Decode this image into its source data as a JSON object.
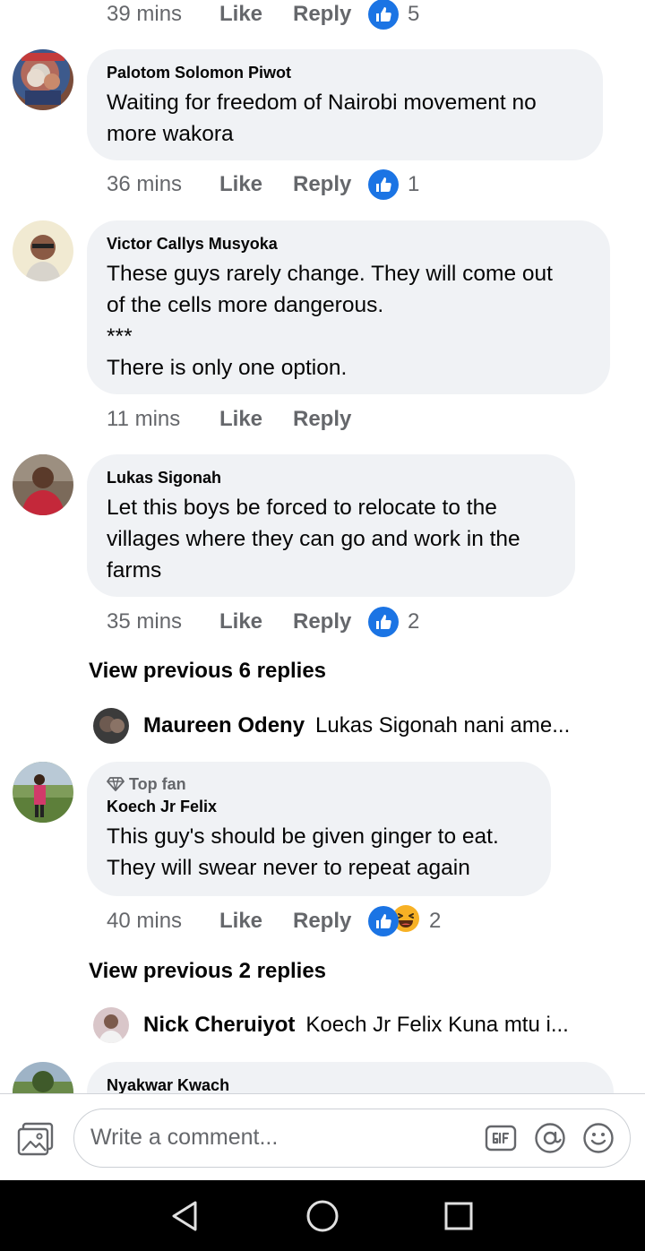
{
  "comments": [
    {
      "meta": {
        "time": "39 mins",
        "like": "Like",
        "reply": "Reply",
        "reactions": "5"
      }
    },
    {
      "author": "Palotom Solomon Piwot",
      "lines": [
        "Waiting for freedom of Nairobi movement no",
        "more wakora"
      ],
      "meta": {
        "time": "36 mins",
        "like": "Like",
        "reply": "Reply",
        "reactions": "1"
      }
    },
    {
      "author": "Victor Callys Musyoka",
      "lines": [
        "These guys rarely change. They will come out",
        "of the cells more dangerous.",
        "***",
        "There is only one option."
      ],
      "meta": {
        "time": "11 mins",
        "like": "Like",
        "reply": "Reply"
      }
    },
    {
      "author": "Lukas Sigonah",
      "lines": [
        "Let this boys be forced to relocate to the",
        "villages where they can go and work in the",
        "farms"
      ],
      "meta": {
        "time": "35 mins",
        "like": "Like",
        "reply": "Reply",
        "reactions": "2"
      },
      "view_previous": "View previous 6 replies",
      "latest_reply": {
        "name": "Maureen Odeny",
        "text": "Lukas Sigonah nani ame..."
      }
    },
    {
      "badge": "Top fan",
      "author": "Koech Jr Felix",
      "lines": [
        "This guy's should be given ginger to eat.",
        "They will swear never to repeat again"
      ],
      "meta": {
        "time": "40 mins",
        "like": "Like",
        "reply": "Reply",
        "reactions": "2"
      },
      "view_previous": "View previous 2 replies",
      "latest_reply": {
        "name": "Nick Cheruiyot",
        "text": "Koech Jr Felix Kuna mtu i..."
      }
    },
    {
      "author": "Nyakwar Kwach"
    }
  ],
  "composer": {
    "placeholder": "Write a comment..."
  },
  "icons": {
    "like_reaction": "like-icon",
    "haha_reaction": "haha-icon",
    "photo": "photo-icon",
    "gif": "gif-icon",
    "mention": "at-icon",
    "emoji": "smiley-icon",
    "top_fan": "diamond-icon",
    "nav": [
      "back-icon",
      "home-icon",
      "recents-icon"
    ]
  },
  "colors": {
    "like_blue": "#1b74e4",
    "bubble_bg": "#f0f2f5",
    "meta_grey": "#65676b",
    "nav_bg": "#000000"
  }
}
